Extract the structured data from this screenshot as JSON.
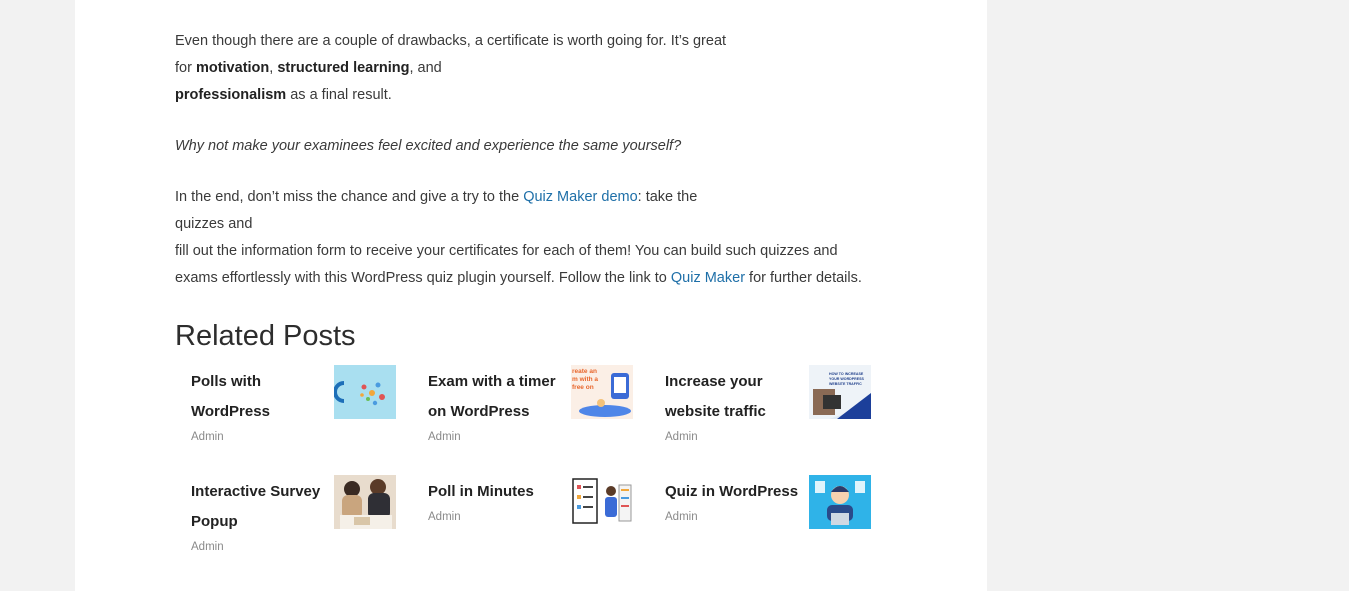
{
  "article": {
    "p1": {
      "line1": "Even though there are a couple of drawbacks, a certificate is worth going for. It’s great",
      "line2_pre": "for ",
      "bold1": "motivation",
      "sep1": ", ",
      "bold2": "structured learning",
      "line2_post": ", and",
      "bold3": "professionalism",
      "line3_post": " as a final result."
    },
    "p2": "Why not make your examinees feel excited and experience the same yourself?",
    "p3": {
      "line1_pre": "In the end, don’t miss the chance and give a try to the ",
      "link1": "Quiz Maker demo",
      "line1_post": ": take the",
      "line2": "quizzes and",
      "line3": "fill out the information form to receive your certificates for each of them! You can build such quizzes and",
      "line4_pre": "exams effortlessly with this WordPress quiz plugin yourself. Follow the link to ",
      "link2": "Quiz Maker",
      "line4_post": " for further details."
    }
  },
  "related": {
    "heading": "Related Posts",
    "posts": [
      {
        "title_line1": "Polls with",
        "title_line2": "WordPress",
        "author": "Admin",
        "thumb_icon": "polls-thumbnail"
      },
      {
        "title_line1": "Exam with a timer",
        "title_line2": "on WordPress",
        "author": "Admin",
        "thumb_icon": "exam-timer-thumbnail",
        "thumb_text": [
          "reate an",
          "m with a",
          "free on"
        ]
      },
      {
        "title_line1": "Increase your",
        "title_line2": "website traffic",
        "author": "Admin",
        "thumb_icon": "traffic-thumbnail",
        "thumb_text": [
          "HOW TO INCREASE",
          "YOUR WORDPRESS",
          "WEBSITE TRAFFIC"
        ]
      },
      {
        "title_line1": "Interactive Survey",
        "title_line2": "Popup",
        "author": "Admin",
        "thumb_icon": "survey-thumbnail"
      },
      {
        "title_line1": "Poll in Minutes",
        "title_line2": "",
        "author": "Admin",
        "thumb_icon": "poll-minutes-thumbnail"
      },
      {
        "title_line1": "Quiz in WordPress",
        "title_line2": "",
        "author": "Admin",
        "thumb_icon": "quiz-thumbnail"
      }
    ]
  },
  "colors": {
    "link": "#1e6fa8",
    "background": "#f2f2f2",
    "page": "#ffffff"
  }
}
